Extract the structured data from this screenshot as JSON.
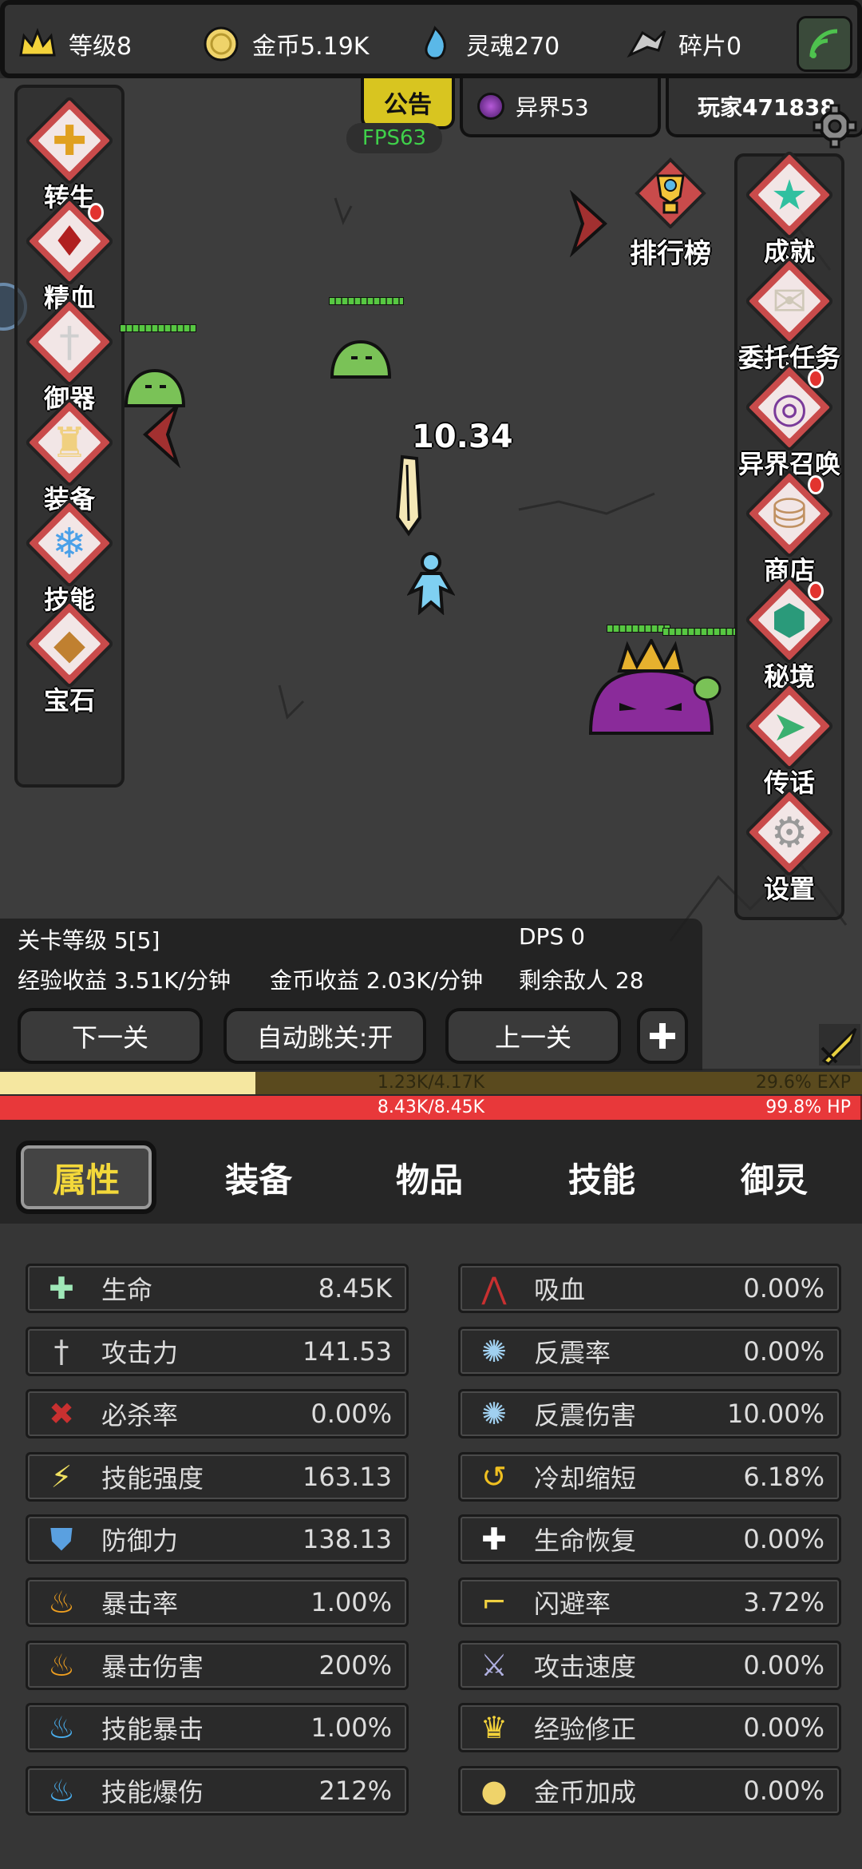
{
  "topbar": {
    "level": "等级8",
    "gold": "金币5.19K",
    "soul": "灵魂270",
    "shard": "碎片0"
  },
  "tabs_top": {
    "notice": "公告",
    "otherworld": "异界53",
    "player": "玩家471838"
  },
  "fps": "FPS63",
  "left_menu": [
    {
      "label": "转生",
      "icon": "cross-shield-icon"
    },
    {
      "label": "精血",
      "icon": "blood-meat-icon"
    },
    {
      "label": "御器",
      "icon": "sword-icon"
    },
    {
      "label": "装备",
      "icon": "armor-icon"
    },
    {
      "label": "技能",
      "icon": "ice-crystal-icon"
    },
    {
      "label": "宝石",
      "icon": "gem-bag-icon"
    }
  ],
  "right_menu": [
    {
      "label": "成就",
      "icon": "star-icon"
    },
    {
      "label": "委托任务",
      "icon": "scroll-icon"
    },
    {
      "label": "异界召唤",
      "icon": "portal-icon"
    },
    {
      "label": "商店",
      "icon": "sack-icon"
    },
    {
      "label": "秘境",
      "icon": "emerald-icon"
    },
    {
      "label": "传话",
      "icon": "megaphone-icon"
    },
    {
      "label": "设置",
      "icon": "gear-icon"
    }
  ],
  "leaderboard": "排行榜",
  "damage": "10.34",
  "stage": {
    "level": "关卡等级 5[5]",
    "dps": "DPS 0",
    "exp_rate": "经验收益 3.51K/分钟",
    "gold_rate": "金币收益 2.03K/分钟",
    "enemies_left": "剩余敌人 28"
  },
  "buttons": {
    "next": "下一关",
    "auto": "自动跳关:开",
    "prev": "上一关"
  },
  "exp_bar": {
    "text": "1.23K/4.17K",
    "percent": "29.6% EXP",
    "fill": 0.296
  },
  "hp_bar": {
    "text": "8.43K/8.45K",
    "percent": "99.8%  HP",
    "fill": 0.998
  },
  "tabs": [
    "属性",
    "装备",
    "物品",
    "技能",
    "御灵"
  ],
  "stats_left": [
    {
      "name": "生命",
      "value": "8.45K",
      "icon": "health-cross-icon"
    },
    {
      "name": "攻击力",
      "value": "141.53",
      "icon": "sword-icon"
    },
    {
      "name": "必杀率",
      "value": "0.00%",
      "icon": "fatal-slash-icon"
    },
    {
      "name": "技能强度",
      "value": "163.13",
      "icon": "lightning-icon"
    },
    {
      "name": "防御力",
      "value": "138.13",
      "icon": "shield-icon"
    },
    {
      "name": "暴击率",
      "value": "1.00%",
      "icon": "fire-icon"
    },
    {
      "name": "暴击伤害",
      "value": "200%",
      "icon": "fire-icon"
    },
    {
      "name": "技能暴击",
      "value": "1.00%",
      "icon": "blue-fire-icon"
    },
    {
      "name": "技能爆伤",
      "value": "212%",
      "icon": "blue-fire-icon"
    }
  ],
  "stats_right": [
    {
      "name": "吸血",
      "value": "0.00%",
      "icon": "bat-icon"
    },
    {
      "name": "反震率",
      "value": "0.00%",
      "icon": "ice-burst-icon"
    },
    {
      "name": "反震伤害",
      "value": "10.00%",
      "icon": "ice-burst-icon"
    },
    {
      "name": "冷却缩短",
      "value": "6.18%",
      "icon": "cooldown-icon"
    },
    {
      "name": "生命恢复",
      "value": "0.00%",
      "icon": "regen-icon"
    },
    {
      "name": "闪避率",
      "value": "3.72%",
      "icon": "boot-icon"
    },
    {
      "name": "攻击速度",
      "value": "0.00%",
      "icon": "attack-speed-icon"
    },
    {
      "name": "经验修正",
      "value": "0.00%",
      "icon": "crown-icon"
    },
    {
      "name": "金币加成",
      "value": "0.00%",
      "icon": "coin-icon"
    }
  ]
}
